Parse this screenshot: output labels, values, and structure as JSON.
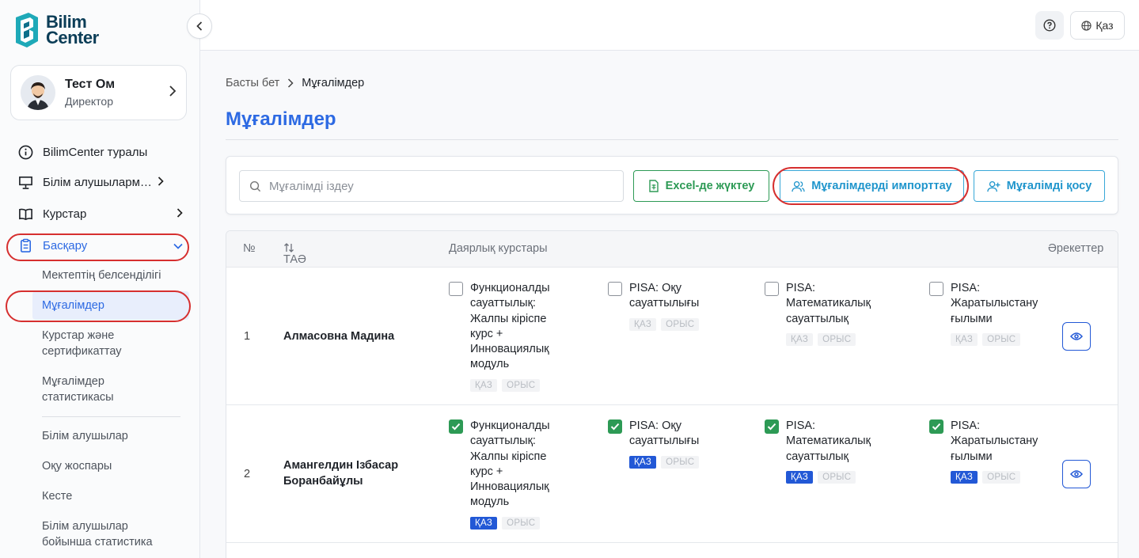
{
  "brand": {
    "line1": "Bilim",
    "line2": "Center"
  },
  "user": {
    "name": "Тест Ом",
    "role": "Директор"
  },
  "nav": {
    "about": "BilimCenter туралы",
    "students": "Білім алушылармен жұмыс",
    "courses": "Курстар",
    "manage": "Басқару",
    "sub": {
      "activity": "Мектептің белсенділігі",
      "teachers": "Мұғалімдер",
      "certification_l1": "Курстар және",
      "certification_l2": "сертификаттау",
      "teacher_stats_l1": "Мұғалімдер",
      "teacher_stats_l2": "статистикасы",
      "learners": "Білім алушылар",
      "plan": "Оқу жоспары",
      "schedule": "Кесте",
      "learner_stats_l1": "Білім алушылар",
      "learner_stats_l2": "бойынша статистика"
    }
  },
  "header": {
    "lang": "Қаз"
  },
  "breadcrumb": {
    "home": "Басты бет",
    "current": "Мұғалімдер"
  },
  "page_title": "Мұғалімдер",
  "toolbar": {
    "search_placeholder": "Мұғалімді іздеу",
    "excel": "Excel-де жүктеу",
    "import": "Мұғалімдерді импорттау",
    "add": "Мұғалімді қосу"
  },
  "table": {
    "col_num": "№",
    "col_name": "ТАӘ",
    "col_courses": "Даярлық курстары",
    "col_actions": "Әрекеттер",
    "tag_kz": "ҚАЗ",
    "tag_ru": "ОРЫС",
    "rows": [
      {
        "num": "1",
        "name": "Алмасовна Мадина",
        "courses": [
          {
            "text": "Функционалды сауаттылық: Жалпы кіріспе курс + Инновациялық модуль",
            "checked": false,
            "kz_active": false
          },
          {
            "text": "PISA: Оқу сауаттылығы",
            "checked": false,
            "kz_active": false
          },
          {
            "text": "PISA: Математикалық сауаттылық",
            "checked": false,
            "kz_active": false
          },
          {
            "text": "PISA: Жаратылыстану ғылыми сауаттылық",
            "checked": false,
            "kz_active": false
          }
        ]
      },
      {
        "num": "2",
        "name": "Амангелдин Ізбасар Боранбайұлы",
        "courses": [
          {
            "text": "Функционалды сауаттылық: Жалпы кіріспе курс + Инновациялық модуль",
            "checked": true,
            "kz_active": true
          },
          {
            "text": "PISA: Оқу сауаттылығы",
            "checked": true,
            "kz_active": true
          },
          {
            "text": "PISA: Математикалық сауаттылық",
            "checked": true,
            "kz_active": true
          },
          {
            "text": "PISA: Жаратылыстану ғылыми сауаттылық",
            "checked": true,
            "kz_active": true
          }
        ]
      }
    ]
  },
  "colors": {
    "accent": "#2d6ae3",
    "green": "#2d9a55",
    "cyan": "#1f95cc",
    "tag_active": "#2258d6",
    "annotation": "#d62f2f"
  }
}
